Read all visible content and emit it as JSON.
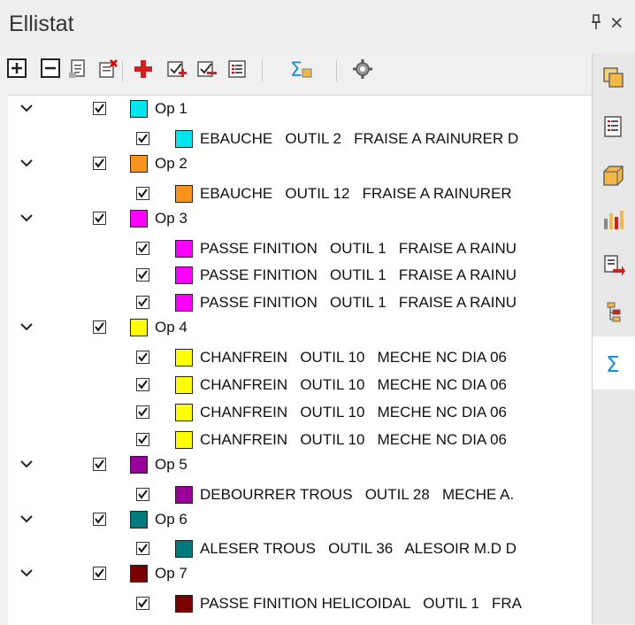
{
  "window": {
    "title": "Ellistat",
    "pin_glyph": "↑",
    "close_glyph": "×"
  },
  "toolbar": [
    "expand-all-icon",
    "collapse-all-icon",
    "copy-icon",
    "delete-icon",
    "add-icon",
    "check-icon",
    "uncheck-icon",
    "list-icon",
    "sum-settings-icon",
    "gear-icon"
  ],
  "operations": [
    {
      "label": "Op 1",
      "color": "#00e5ee",
      "children": [
        "EBAUCHE   OUTIL 2   FRAISE A RAINURER D"
      ]
    },
    {
      "label": "Op 2",
      "color": "#f7941d",
      "children": [
        "EBAUCHE   OUTIL 12   FRAISE A RAINURER"
      ]
    },
    {
      "label": "Op 3",
      "color": "#ff00ff",
      "children": [
        "PASSE FINITION   OUTIL 1   FRAISE A RAINU",
        "PASSE FINITION   OUTIL 1   FRAISE A RAINU",
        "PASSE FINITION   OUTIL 1   FRAISE A RAINU"
      ]
    },
    {
      "label": "Op 4",
      "color": "#ffff00",
      "children": [
        "CHANFREIN   OUTIL 10   MECHE NC DIA 06",
        "CHANFREIN   OUTIL 10   MECHE NC DIA 06",
        "CHANFREIN   OUTIL 10   MECHE NC DIA 06",
        "CHANFREIN   OUTIL 10   MECHE NC DIA 06"
      ]
    },
    {
      "label": "Op 5",
      "color": "#990099",
      "children": [
        "DEBOURRER TROUS   OUTIL 28   MECHE A."
      ]
    },
    {
      "label": "Op 6",
      "color": "#007b7b",
      "children": [
        "ALESER TROUS   OUTIL 36   ALESOIR M.D D"
      ]
    },
    {
      "label": "Op 7",
      "color": "#7a0000",
      "children": [
        "PASSE FINITION HELICOIDAL   OUTIL 1   FRA"
      ]
    }
  ],
  "sidebar": [
    "layers-icon",
    "list-icon",
    "box-icon",
    "chart-icon",
    "transfer-icon",
    "tree-icon",
    "sigma-icon"
  ],
  "sidebar_active": 6
}
